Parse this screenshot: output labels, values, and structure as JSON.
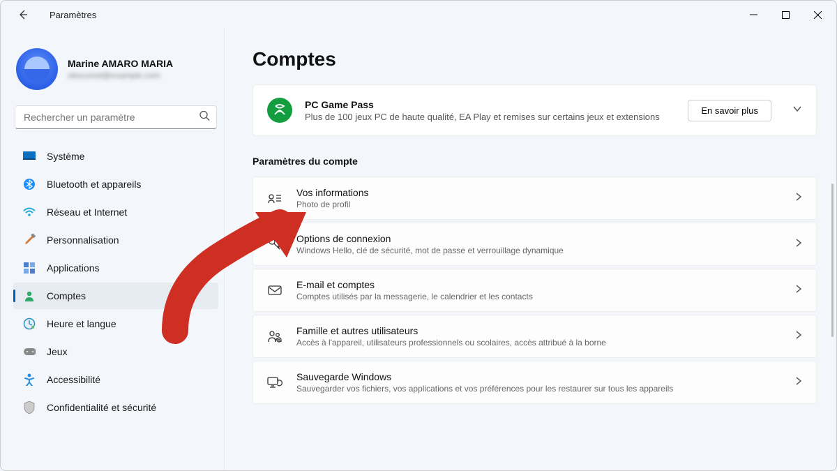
{
  "app": {
    "title": "Paramètres"
  },
  "user": {
    "name": "Marine AMARO MARIA",
    "email": "obscured@example.com"
  },
  "search": {
    "placeholder": "Rechercher un paramètre"
  },
  "nav": {
    "items": [
      {
        "label": "Système",
        "icon": "display"
      },
      {
        "label": "Bluetooth et appareils",
        "icon": "bluetooth"
      },
      {
        "label": "Réseau et Internet",
        "icon": "wifi"
      },
      {
        "label": "Personnalisation",
        "icon": "brush"
      },
      {
        "label": "Applications",
        "icon": "apps"
      },
      {
        "label": "Comptes",
        "icon": "person"
      },
      {
        "label": "Heure et langue",
        "icon": "clock"
      },
      {
        "label": "Jeux",
        "icon": "gamepad"
      },
      {
        "label": "Accessibilité",
        "icon": "accessibility"
      },
      {
        "label": "Confidentialité et sécurité",
        "icon": "shield"
      }
    ]
  },
  "page": {
    "title": "Comptes",
    "promo": {
      "title": "PC Game Pass",
      "sub": "Plus de 100 jeux PC de haute qualité, EA Play et remises sur certains jeux et extensions",
      "button": "En savoir plus"
    },
    "section_title": "Paramètres du compte",
    "items": [
      {
        "title": "Vos informations",
        "sub": "Photo de profil",
        "icon": "contact"
      },
      {
        "title": "Options de connexion",
        "sub": "Windows Hello, clé de sécurité, mot de passe et verrouillage dynamique",
        "icon": "key"
      },
      {
        "title": "E-mail et comptes",
        "sub": "Comptes utilisés par la messagerie, le calendrier et les contacts",
        "icon": "mail"
      },
      {
        "title": "Famille et autres utilisateurs",
        "sub": "Accès à l'appareil, utilisateurs professionnels ou scolaires, accès attribué à la borne",
        "icon": "family"
      },
      {
        "title": "Sauvegarde Windows",
        "sub": "Sauvegarder vos fichiers, vos applications et vos préférences pour les restaurer sur tous les appareils",
        "icon": "backup"
      }
    ]
  }
}
